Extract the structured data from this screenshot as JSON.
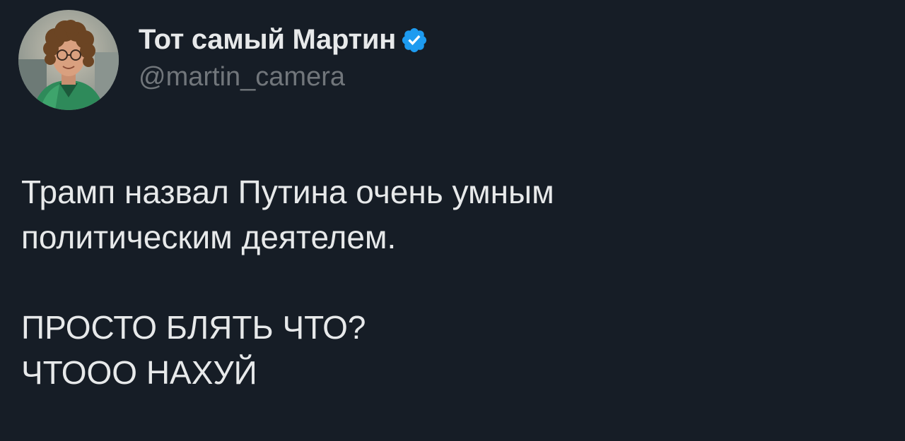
{
  "author": {
    "display_name": "Тот самый Мартин",
    "handle": "@martin_camera",
    "verified": true,
    "badge_color": "#1d9bf0"
  },
  "tweet": {
    "paragraphs": [
      "Трамп назвал Путина очень умным\nполитическим деятелем.",
      "ПРОСТО БЛЯТЬ ЧТО?\nЧТООО НАХУЙ"
    ]
  },
  "colors": {
    "background": "#161d26",
    "text_primary": "#e7e9ea",
    "text_secondary": "#71767b"
  }
}
